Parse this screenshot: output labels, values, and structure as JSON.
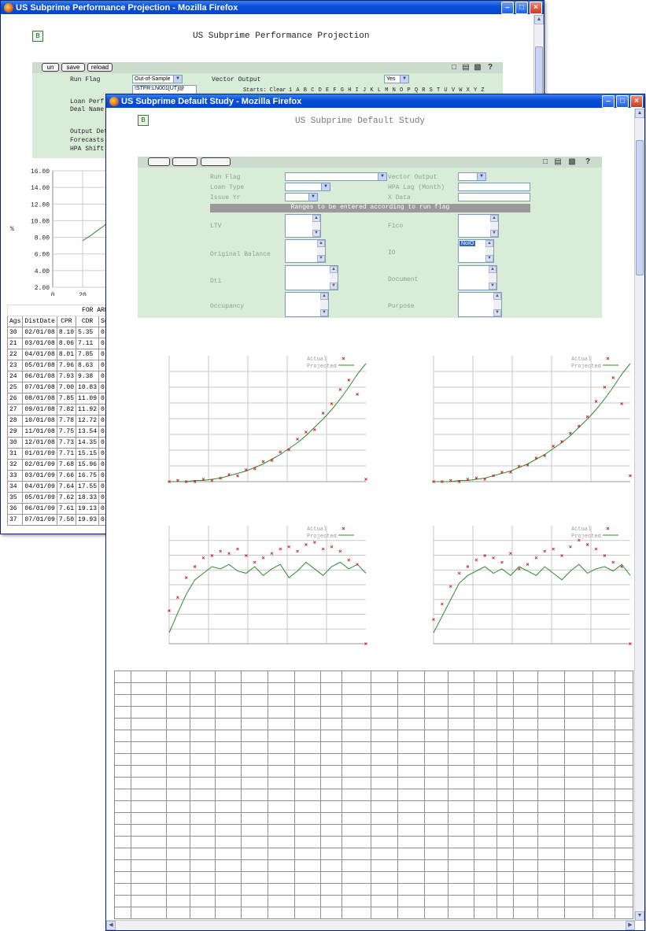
{
  "back_window": {
    "title": "US Subprime Performance Projection - Mozilla Firefox",
    "page_title": "US Subprime Performance Projection",
    "logo": "B",
    "buttons": [
      "un",
      "save",
      "reload"
    ],
    "labels": {
      "run_flag": "Run Flag",
      "vector_output": "Vector Output",
      "loan_perf": "Loan Perf",
      "deal_name": "Deal Name",
      "output_det": "Output Det",
      "forecasts": "Forecasts",
      "hpa_shift": "HPA Shift"
    },
    "run_flag_value": "Out-of-Sample",
    "vector_output_value": "Yes",
    "deal_list_value": "!STFR:LN001[UT]@",
    "letters_prefix": "Starts: Clear",
    "letters": "1 A B C D E F G H I J K L M N O P Q R S T U V W X Y Z",
    "chart_data": {
      "type": "line",
      "x": [
        20,
        22,
        24,
        26
      ],
      "values": [
        7.6,
        8.2,
        8.9,
        9.6
      ],
      "ylim": [
        2.0,
        16.0
      ],
      "yticks": [
        "16.00",
        "14.00",
        "12.00",
        "10.00",
        "8.00",
        "6.00",
        "4.00",
        "2.00"
      ],
      "xticks": [
        "0",
        "20"
      ],
      "ylabel": "%",
      "color": "#2e8b2e"
    },
    "table": {
      "group_header": "FOR ARR",
      "headers": [
        "Ags",
        "DistDate",
        "CPR",
        "CDR",
        "Se"
      ],
      "rows": [
        [
          "30",
          "02/01/08",
          "8.10",
          "5.35",
          "0."
        ],
        [
          "21",
          "03/01/08",
          "8.06",
          "7.11",
          "0."
        ],
        [
          "22",
          "04/01/08",
          "8.01",
          "7.85",
          "0."
        ],
        [
          "23",
          "05/01/08",
          "7.96",
          "8.63",
          "0."
        ],
        [
          "24",
          "06/01/08",
          "7.93",
          "9.38",
          "0."
        ],
        [
          "25",
          "07/01/08",
          "7.00",
          "10.83",
          "0."
        ],
        [
          "26",
          "08/01/08",
          "7.85",
          "11.09",
          "0."
        ],
        [
          "27",
          "09/01/08",
          "7.82",
          "11.92",
          "0."
        ],
        [
          "28",
          "10/01/08",
          "7.78",
          "12.72",
          "0."
        ],
        [
          "29",
          "11/01/08",
          "7.75",
          "13.54",
          "0."
        ],
        [
          "30",
          "12/01/08",
          "7.73",
          "14.35",
          "0."
        ],
        [
          "31",
          "01/01/09",
          "7.71",
          "15.15",
          "0."
        ],
        [
          "32",
          "02/01/09",
          "7.68",
          "15.96",
          "0."
        ],
        [
          "33",
          "03/01/09",
          "7.66",
          "16.75",
          "0."
        ],
        [
          "34",
          "04/01/09",
          "7.64",
          "17.55",
          "0."
        ],
        [
          "35",
          "05/01/09",
          "7.62",
          "18.33",
          "0."
        ],
        [
          "36",
          "06/01/09",
          "7.61",
          "19.13",
          "0."
        ],
        [
          "37",
          "07/01/09",
          "7.50",
          "19.93",
          "0."
        ]
      ]
    }
  },
  "front_window": {
    "title": "US Subprime Default Study - Mozilla Firefox",
    "page_title": "US Subprime Default Study",
    "logo": "B",
    "labels": {
      "run_flag": "Run Flag",
      "vector_output": "Vector Output",
      "loan_type": "Loan Type",
      "hpa_lag": "HPA Lag (Month)",
      "issue_yr": "Issue Yr",
      "x_data": "X Data",
      "ltv": "LTV",
      "fico": "Fico",
      "original_balance": "Original Balance",
      "io": "IO",
      "dti": "Dti",
      "document": "Document",
      "occupancy": "Occupancy",
      "purpose": "Purpose"
    },
    "ranges_banner": "Ranges to be entered according to run flag",
    "io_selected": "NoIO",
    "legend": {
      "actual": "Actual",
      "projected": "Projected"
    },
    "charts": [
      {
        "type": "line",
        "shape": "convex",
        "legend_position": "top-right",
        "actual_color": "#d42020",
        "projected_color": "#2e8b2e",
        "projected": [
          0.0,
          0.0,
          0.0,
          0.01,
          0.01,
          0.02,
          0.03,
          0.05,
          0.07,
          0.09,
          0.12,
          0.15,
          0.19,
          0.23,
          0.28,
          0.33,
          0.39,
          0.46,
          0.53,
          0.61,
          0.7,
          0.8,
          0.91,
          1.0
        ],
        "actual": [
          0.0,
          0.01,
          0.0,
          0.0,
          0.02,
          0.01,
          0.03,
          0.06,
          0.05,
          0.1,
          0.11,
          0.17,
          0.18,
          0.25,
          0.27,
          0.36,
          0.42,
          0.44,
          0.58,
          0.66,
          0.78,
          0.86,
          0.74,
          0.02
        ]
      },
      {
        "type": "line",
        "shape": "convex",
        "legend_position": "top-right",
        "actual_color": "#d42020",
        "projected_color": "#2e8b2e",
        "projected": [
          0.0,
          0.0,
          0.0,
          0.01,
          0.01,
          0.02,
          0.03,
          0.05,
          0.07,
          0.09,
          0.12,
          0.15,
          0.19,
          0.23,
          0.28,
          0.33,
          0.39,
          0.46,
          0.53,
          0.61,
          0.7,
          0.8,
          0.91,
          1.0
        ],
        "actual": [
          0.0,
          0.0,
          0.01,
          0.0,
          0.02,
          0.03,
          0.02,
          0.05,
          0.08,
          0.08,
          0.13,
          0.14,
          0.2,
          0.22,
          0.3,
          0.34,
          0.41,
          0.47,
          0.55,
          0.68,
          0.8,
          0.88,
          0.66,
          0.05
        ]
      },
      {
        "type": "line",
        "shape": "plateau",
        "legend_position": "top-right",
        "actual_color": "#d42020",
        "projected_color": "#2e8b2e",
        "projected": [
          0.1,
          0.28,
          0.45,
          0.58,
          0.64,
          0.7,
          0.68,
          0.72,
          0.66,
          0.64,
          0.7,
          0.62,
          0.68,
          0.72,
          0.6,
          0.66,
          0.74,
          0.68,
          0.62,
          0.7,
          0.74,
          0.68,
          0.72,
          0.64
        ],
        "actual": [
          0.3,
          0.42,
          0.6,
          0.7,
          0.78,
          0.8,
          0.84,
          0.82,
          0.86,
          0.8,
          0.74,
          0.78,
          0.82,
          0.86,
          0.88,
          0.84,
          0.9,
          0.92,
          0.86,
          0.88,
          0.84,
          0.76,
          0.72,
          0.0
        ]
      },
      {
        "type": "line",
        "shape": "plateau",
        "legend_position": "top-right",
        "actual_color": "#d42020",
        "projected_color": "#2e8b2e",
        "projected": [
          0.1,
          0.25,
          0.4,
          0.55,
          0.62,
          0.66,
          0.7,
          0.64,
          0.68,
          0.62,
          0.7,
          0.66,
          0.62,
          0.7,
          0.64,
          0.58,
          0.66,
          0.72,
          0.64,
          0.68,
          0.7,
          0.66,
          0.72,
          0.62
        ],
        "actual": [
          0.22,
          0.36,
          0.52,
          0.64,
          0.7,
          0.76,
          0.8,
          0.78,
          0.74,
          0.82,
          0.68,
          0.72,
          0.78,
          0.84,
          0.86,
          0.8,
          0.88,
          0.94,
          0.9,
          0.86,
          0.8,
          0.74,
          0.7,
          0.0
        ]
      }
    ]
  }
}
